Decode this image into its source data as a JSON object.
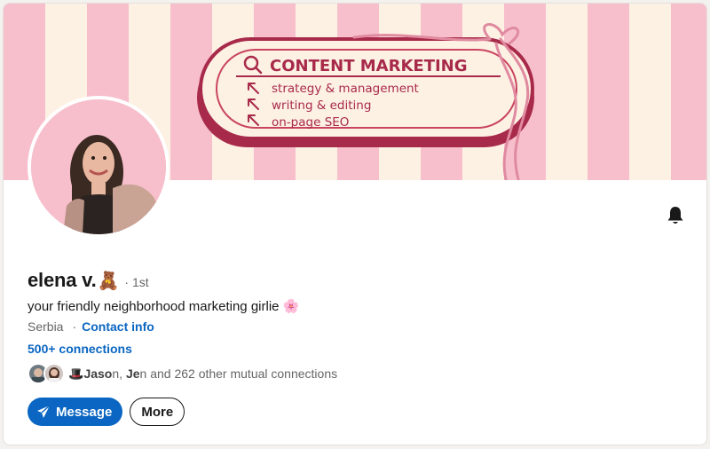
{
  "banner": {
    "title": "CONTENT MARKETING",
    "items": [
      "strategy & management",
      "writing & editing",
      "on-page SEO"
    ]
  },
  "profile": {
    "name": "elena v.",
    "name_emoji": "🧸",
    "degree": "· 1st",
    "headline": "your friendly neighborhood marketing girlie 🌸",
    "location": "Serbia",
    "location_separator": "·",
    "contact_label": "Contact info",
    "connections_label": "500+ connections",
    "mutual": {
      "prefix_emoji": "🎩",
      "name1": "Jaso",
      "name1_rest": "n, ",
      "name2": "Je",
      "name2_rest": "n and 262 other mutual connections"
    }
  },
  "actions": {
    "message_label": "Message",
    "more_label": "More"
  },
  "icons": {
    "bell": "bell-icon",
    "send": "send-icon",
    "search": "search-icon",
    "arrow": "arrow-up-left-icon"
  },
  "colors": {
    "accent": "#0a66c2",
    "banner_pink": "#f7bfcc",
    "banner_cream": "#fdf1e4",
    "banner_maroon": "#a82a4a"
  }
}
